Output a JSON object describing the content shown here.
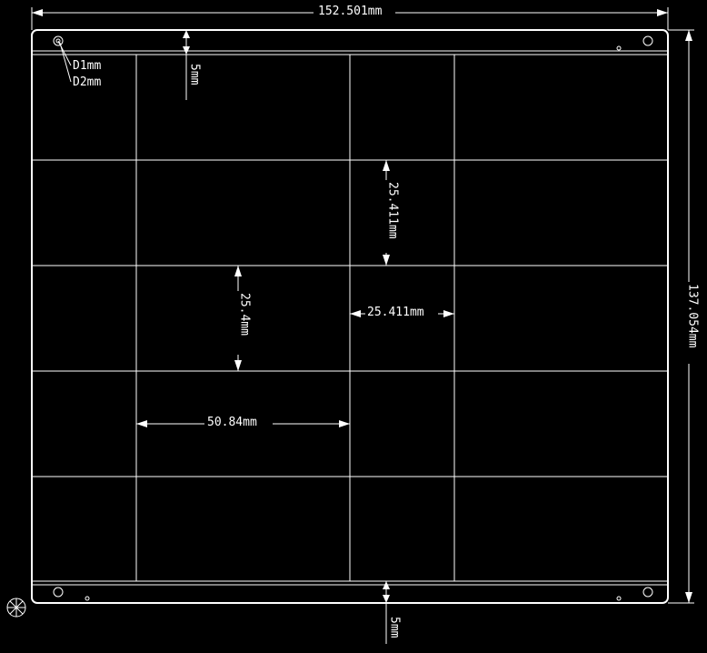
{
  "dims": {
    "overall_width": "152.501mm",
    "overall_height": "137.054mm",
    "margin_top": "5mm",
    "margin_bottom": "5mm",
    "cell_h_wide": "50.84mm",
    "cell_h_small": "25.411mm",
    "cell_v_small": "25.411mm",
    "cell_v_mid": "25.4mm"
  },
  "holes": {
    "d1": "D1mm",
    "d2": "D2mm"
  }
}
